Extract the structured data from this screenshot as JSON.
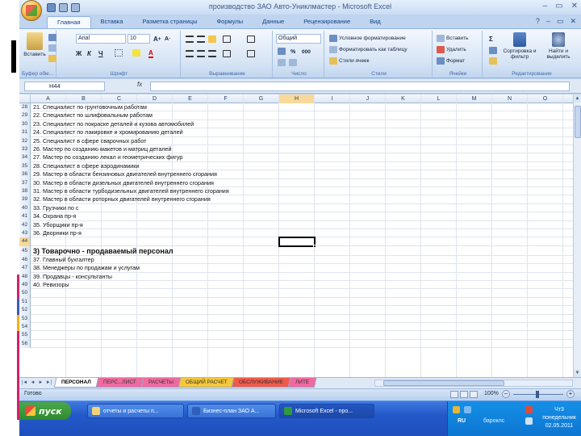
{
  "window": {
    "title": "производство ЗАО Авто-Униклмастер - Microsoft Excel",
    "controls": [
      "–",
      "▭",
      "✕"
    ]
  },
  "ribbon": {
    "tabs": [
      "Главная",
      "Вставка",
      "Разметка страницы",
      "Формулы",
      "Данные",
      "Рецензирование",
      "Вид"
    ],
    "active_tab": "Главная",
    "clipboard": {
      "label": "Буфер обм...",
      "paste": "Вставить"
    },
    "font": {
      "label": "Шрифт",
      "name": "Arial",
      "size": "10",
      "bold": "Ж",
      "italic": "К",
      "underline": "Ч"
    },
    "alignment": {
      "label": "Выравнивание"
    },
    "number": {
      "label": "Число",
      "format": "Общий",
      "percent": "%",
      "thousands": "000"
    },
    "styles": {
      "label": "Стили",
      "conditional": "Условное форматирование",
      "as_table": "Форматировать как таблицу",
      "cell_styles": "Стили ячеек"
    },
    "cells": {
      "label": "Ячейки",
      "insert": "Вставить",
      "delete": "Удалить",
      "format": "Формат"
    },
    "editing": {
      "label": "Редактирование",
      "sort": "Сортировка и фильтр",
      "find": "Найти и выделить",
      "sum": "Σ"
    }
  },
  "formula_bar": {
    "name_box": "H44",
    "fx": "fx",
    "content": ""
  },
  "columns": [
    "A",
    "B",
    "C",
    "D",
    "E",
    "F",
    "G",
    "H",
    "I",
    "J",
    "K",
    "L",
    "M",
    "N",
    "O"
  ],
  "selected_column": "H",
  "rows": [
    {
      "num": "28",
      "text": "21. Специалист по грунтовочным работам"
    },
    {
      "num": "29",
      "text": "22. Специалист по шлифовальным работам"
    },
    {
      "num": "30",
      "text": "23. Специалист по покраске деталей и кузова автомобилей"
    },
    {
      "num": "31",
      "text": "24. Специалист по лакировке и хромированию деталей"
    },
    {
      "num": "32",
      "text": "25. Специалист в сфере сварочных работ"
    },
    {
      "num": "33",
      "text": "26. Мастер по созданию макетов и матриц деталей"
    },
    {
      "num": "34",
      "text": "27. Мастер по созданию лекал и геометрических фигур"
    },
    {
      "num": "35",
      "text": "28. Специалист в сфере аэродинамики"
    },
    {
      "num": "36",
      "text": "29. Мастер в области бензиновых двигателей внутреннего сгорания"
    },
    {
      "num": "37",
      "text": "30. Мастер в области дизельных двигателей внутреннего сгорания"
    },
    {
      "num": "38",
      "text": "31. Мастер в области турбодизельных двигателей внутреннего сгорания"
    },
    {
      "num": "39",
      "text": "32. Мастер в области роторных двигателей внутреннего сгорания"
    },
    {
      "num": "40",
      "text": "33. Грузчики по с"
    },
    {
      "num": "41",
      "text": "34. Охрана пр-я"
    },
    {
      "num": "42",
      "text": "35. Уборщики пр-я"
    },
    {
      "num": "43",
      "text": "36. Дворники пр-я"
    },
    {
      "num": "44",
      "text": ""
    },
    {
      "num": "45",
      "text": "3) Товарочно - продаваемый персонал",
      "heading": true
    },
    {
      "num": "46",
      "text": "37. Главный бухгалтер"
    },
    {
      "num": "47",
      "text": "38. Менеджеры по продажам и услугам"
    },
    {
      "num": "48",
      "text": "39. Продавцы - консультанты"
    },
    {
      "num": "49",
      "text": "40. Ревизоры"
    },
    {
      "num": "50",
      "text": ""
    },
    {
      "num": "51",
      "text": ""
    },
    {
      "num": "52",
      "text": ""
    },
    {
      "num": "53",
      "text": ""
    },
    {
      "num": "54",
      "text": ""
    },
    {
      "num": "55",
      "text": ""
    },
    {
      "num": "56",
      "text": ""
    }
  ],
  "selected_row": "44",
  "sheets": [
    "ПЕРСОНАЛ",
    "ПЕРС...ЛИСТ",
    "РАСЧЕТЫ",
    "ОБЩИЙ РАСЧЕТ",
    "ОБСЛУЖИВАНИЕ",
    "ЛИТЕ"
  ],
  "active_sheet": "ПЕРСОНАЛ",
  "status": {
    "text": "Готово",
    "zoom": "100%"
  },
  "taskbar": {
    "start": "пуск",
    "tasks": [
      "отчеты и расчеты п...",
      "Бизнес-план ЗАО А...",
      "Microsoft Excel - про..."
    ],
    "active_task": 2,
    "lang": "RU",
    "tray_label": "бароклс",
    "clock_time": "Чт3",
    "clock_day": "понедельник",
    "clock_date": "02.05.2011"
  },
  "colors": {
    "ribbon_bg": "#d6e4f5",
    "selection": "#f9d99a",
    "taskbar": "#2458c9",
    "start_green": "#3a9a3b"
  }
}
